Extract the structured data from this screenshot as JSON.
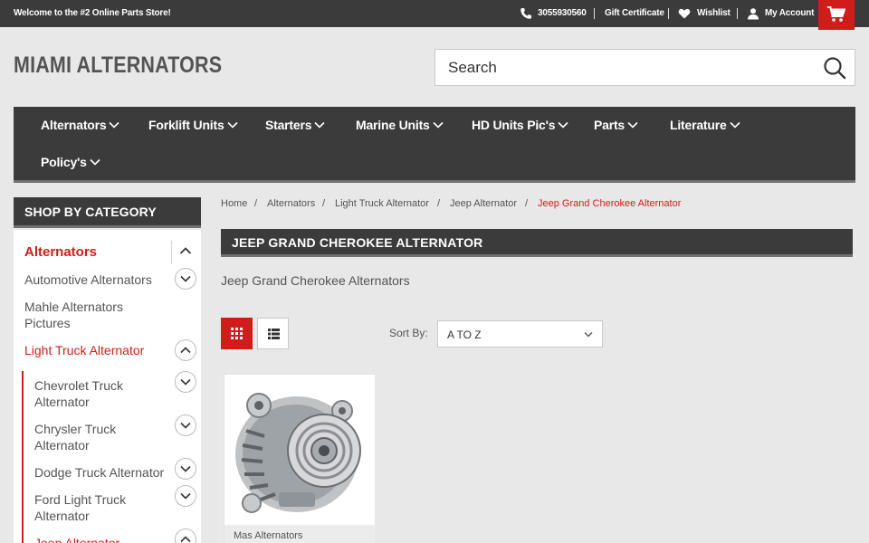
{
  "topbar": {
    "welcome": "Welcome to the #2 Online Parts Store!",
    "phone": "3055930560",
    "gift": "Gift Certificate",
    "wishlist": "Wishlist",
    "account": "My Account"
  },
  "header": {
    "logo": "MIAMI ALTERNATORS",
    "search_placeholder": "Search"
  },
  "nav": {
    "items": [
      "Alternators",
      "Forklift Units",
      "Starters",
      "Marine Units",
      "HD Units Pic's",
      "Parts",
      "Literature",
      "Policy's"
    ]
  },
  "sidebar": {
    "heading": "SHOP BY CATEGORY",
    "items": [
      "Alternators",
      "Automotive Alternators",
      "Mahle Alternators Pictures",
      "Light Truck Alternator",
      "Chevrolet Truck Alternator",
      "Chrysler Truck Alternator",
      "Dodge Truck Alternator",
      "Ford Light Truck Alternator",
      "Jeep Alternator"
    ]
  },
  "breadcrumb": [
    "Home",
    "Alternators",
    "Light Truck Alternator",
    "Jeep Alternator",
    "Jeep Grand Cherokee Alternator"
  ],
  "page": {
    "title": "JEEP GRAND CHEROKEE ALTERNATOR",
    "description": "Jeep Grand Cherokee Alternators",
    "sort_label": "Sort By:",
    "sort_value": "A TO Z"
  },
  "products": [
    {
      "brand": "Mas Alternators"
    }
  ],
  "colors": {
    "accent": "#d01d19",
    "dark": "#3b3b3b",
    "background": "#e8e8e8"
  }
}
